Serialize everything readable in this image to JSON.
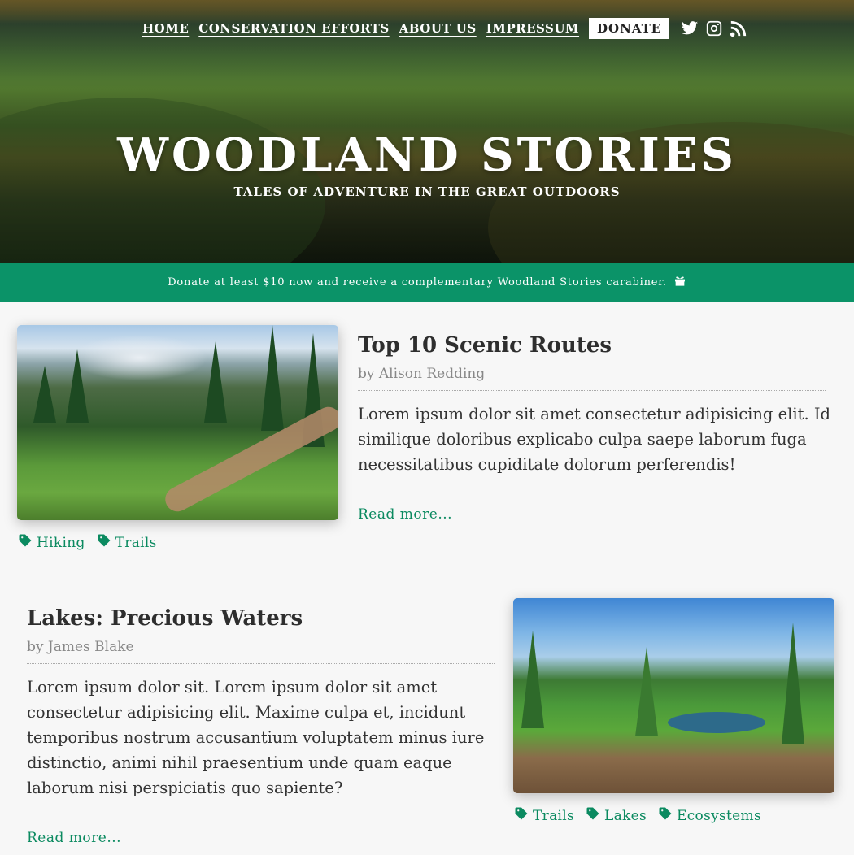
{
  "nav": {
    "links": [
      "HOME",
      "CONSERVATION EFFORTS",
      "ABOUT US",
      "IMPRESSUM"
    ],
    "donate_label": "DONATE",
    "social_icons": [
      "twitter-icon",
      "instagram-icon",
      "rss-icon"
    ]
  },
  "hero": {
    "title": "WOODLAND STORIES",
    "subtitle": "TALES OF ADVENTURE IN THE GREAT OUTDOORS"
  },
  "banner": {
    "text": "Donate at least $10 now and receive a complementary Woodland Stories carabiner.",
    "icon": "gift-icon"
  },
  "articles": [
    {
      "title": "Top 10 Scenic Routes",
      "author": "by Alison Redding",
      "body": "Lorem ipsum dolor sit amet consectetur adipisicing elit. Id similique doloribus explicabo culpa saepe laborum fuga necessitatibus cupiditate dolorum perferendis!",
      "read_more": "Read more...",
      "tags": [
        "Hiking",
        "Trails"
      ]
    },
    {
      "title": "Lakes: Precious Waters",
      "author": "by James Blake",
      "body": "Lorem ipsum dolor sit. Lorem ipsum dolor sit amet consectetur adipisicing elit. Maxime culpa et, incidunt temporibus nostrum accusantium voluptatem minus iure distinctio, animi nihil praesentium unde quam eaque laborum nisi perspiciatis quo sapiente?",
      "read_more": "Read more...",
      "tags": [
        "Trails",
        "Lakes",
        "Ecosystems"
      ]
    }
  ],
  "colors": {
    "accent": "#0b9368",
    "link": "#0b8a60",
    "background": "#f7f7f7"
  }
}
